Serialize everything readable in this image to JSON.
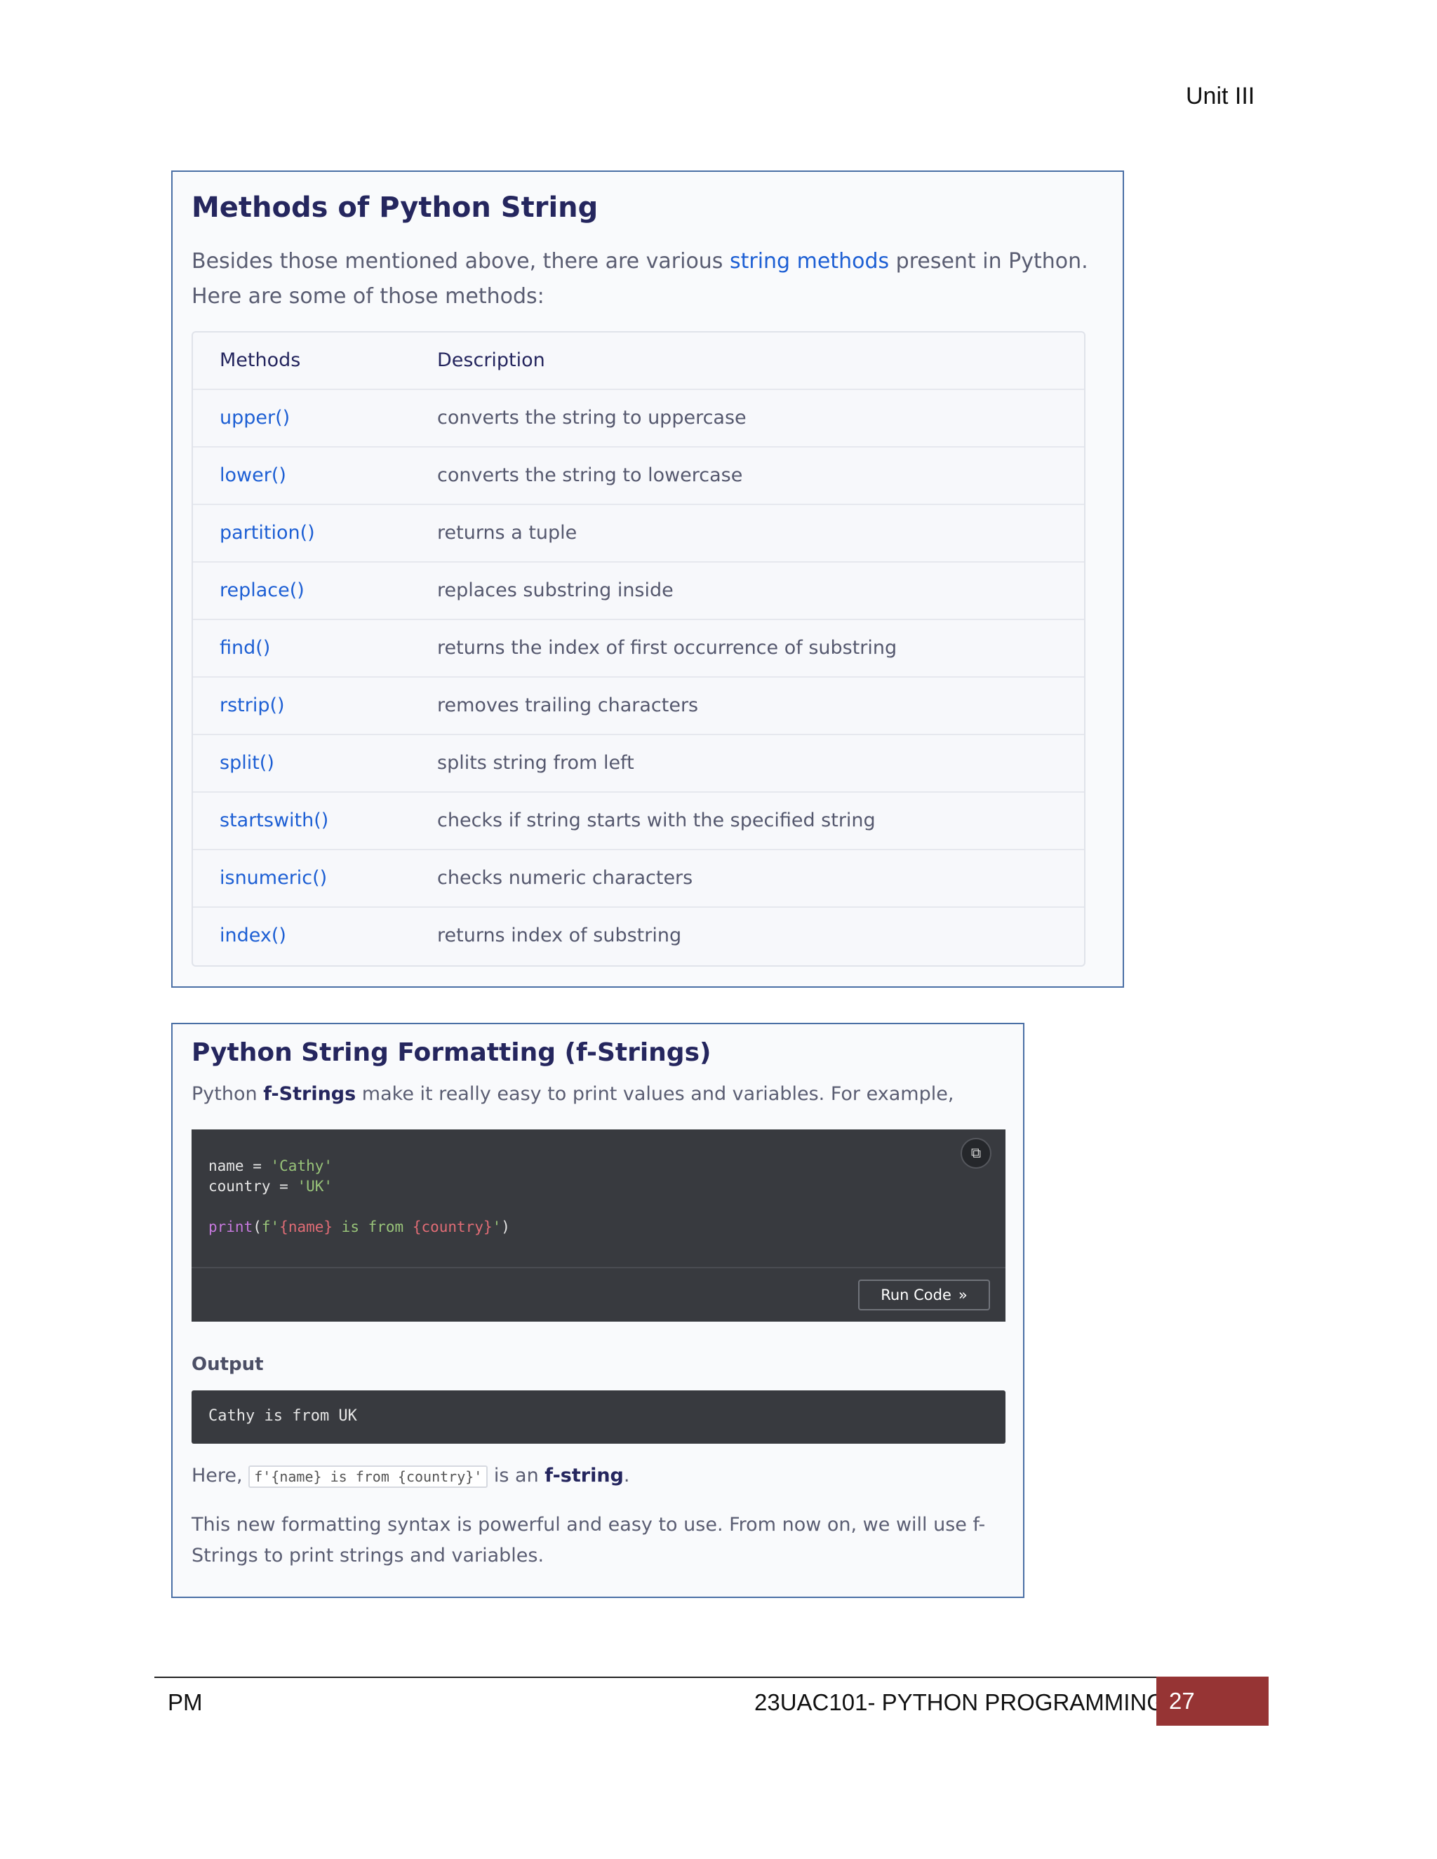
{
  "header": {
    "unit": "Unit III"
  },
  "methods_card": {
    "title": "Methods of Python String",
    "intro_before": "Besides those mentioned above, there are various ",
    "intro_link": "string methods",
    "intro_after": " present in Python. Here are some of those methods:",
    "table": {
      "columns": [
        "Methods",
        "Description"
      ],
      "rows": [
        [
          "upper()",
          "converts the string to uppercase"
        ],
        [
          "lower()",
          "converts the string to lowercase"
        ],
        [
          "partition()",
          "returns a tuple"
        ],
        [
          "replace()",
          "replaces substring inside"
        ],
        [
          "find()",
          "returns the index of first occurrence of substring"
        ],
        [
          "rstrip()",
          "removes trailing characters"
        ],
        [
          "split()",
          "splits string from left"
        ],
        [
          "startswith()",
          "checks if string starts with the specified string"
        ],
        [
          "isnumeric()",
          "checks numeric characters"
        ],
        [
          "index()",
          "returns index of substring"
        ]
      ]
    }
  },
  "fstring_card": {
    "title": "Python String Formatting (f-Strings)",
    "intro_before": "Python ",
    "intro_bold": "f-Strings",
    "intro_after": " make it really easy to print values and variables. For example,",
    "code": {
      "line1_var": "name",
      "line1_op": " = ",
      "line1_str": "'Cathy'",
      "line2_var": "country",
      "line2_op": " = ",
      "line2_str": "'UK'",
      "line4_fn": "print",
      "line4_open": "(",
      "line4_prefix": "f'",
      "line4_ph1": "{name}",
      "line4_mid": " is from ",
      "line4_ph2": "{country}",
      "line4_end": "'",
      "line4_close": ")"
    },
    "copy_icon": "copy-icon",
    "run_button": "Run Code",
    "run_icon": "»",
    "output_label": "Output",
    "output_text": "Cathy is from UK",
    "here_before": "Here, ",
    "here_code": "f'{name} is from {country}'",
    "here_mid": " is an ",
    "here_bold": "f-string",
    "here_after": ".",
    "closing": "This new formatting syntax is powerful and easy to use. From now on, we will use f-Strings to print strings and variables."
  },
  "footer": {
    "left": "PM",
    "course": "23UAC101- PYTHON PROGRAMMING",
    "page": "27"
  }
}
